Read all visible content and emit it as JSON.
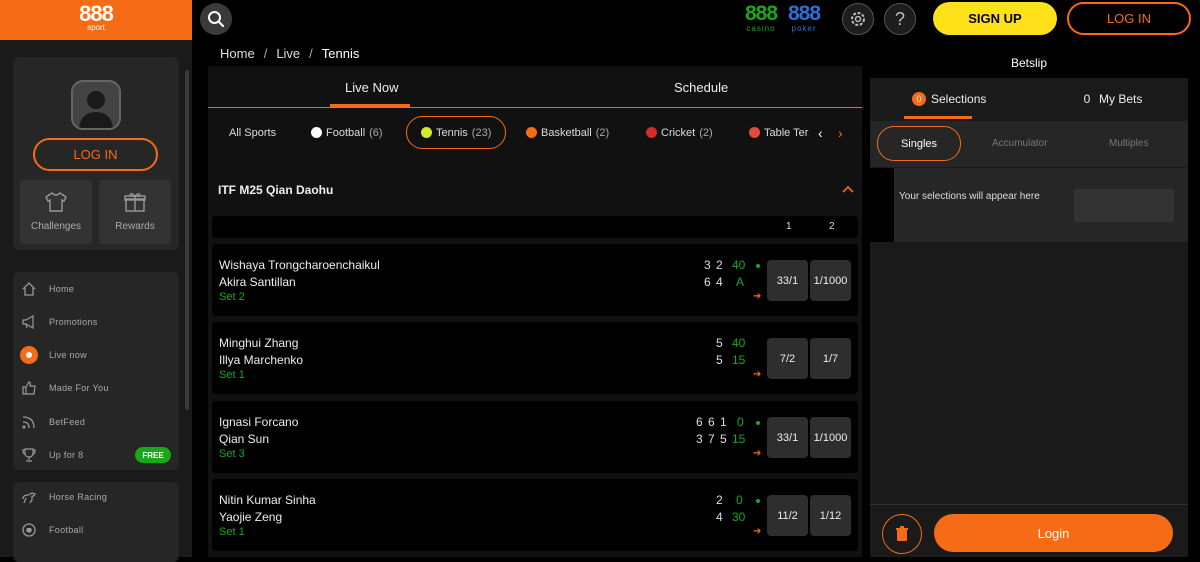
{
  "logo": {
    "main": "888",
    "sub": "sport"
  },
  "brands": [
    {
      "main": "888",
      "sub": "casino",
      "color": "#18a81a"
    },
    {
      "main": "888",
      "sub": "poker",
      "color": "#2b6fd6"
    }
  ],
  "header": {
    "signup_label": "SIGN UP",
    "login_label": "LOG IN"
  },
  "sidebar": {
    "login_label": "LOG IN",
    "tiles": [
      {
        "label": "Challenges",
        "icon": "shirt-icon"
      },
      {
        "label": "Rewards",
        "icon": "gift-icon"
      }
    ],
    "nav": [
      {
        "label": "Home",
        "icon": "home-icon"
      },
      {
        "label": "Promotions",
        "icon": "megaphone-icon"
      },
      {
        "label": "Live now",
        "icon": "live-icon"
      },
      {
        "label": "Made For You",
        "icon": "thumbs-up-icon"
      },
      {
        "label": "BetFeed",
        "icon": "feed-icon"
      },
      {
        "label": "Up for 8",
        "icon": "trophy-icon",
        "badge": "FREE"
      }
    ],
    "nav2": [
      {
        "label": "Horse Racing",
        "icon": "horse-icon"
      },
      {
        "label": "Football",
        "icon": "football-icon"
      }
    ]
  },
  "breadcrumb": {
    "items": [
      "Home",
      "Live",
      "Tennis"
    ]
  },
  "tabs": {
    "live_now": "Live Now",
    "schedule": "Schedule"
  },
  "sports": [
    {
      "label": "All Sports",
      "count": ""
    },
    {
      "label": "Football",
      "count": "(6)"
    },
    {
      "label": "Tennis",
      "count": "(23)"
    },
    {
      "label": "Basketball",
      "count": "(2)"
    },
    {
      "label": "Cricket",
      "count": "(2)"
    },
    {
      "label": "Table Ter",
      "count": ""
    }
  ],
  "league": {
    "name": "ITF M25 Qian Daohu"
  },
  "columns": {
    "c1": "1",
    "c2": "2"
  },
  "matches": [
    {
      "p1": "Wishaya Trongcharoenchaikul",
      "p2": "Akira Santillan",
      "set": "Set 2",
      "s1": [
        "3",
        "2",
        "40"
      ],
      "s2": [
        "6",
        "4",
        "A"
      ],
      "odd1": "33/1",
      "odd2": "1/1000"
    },
    {
      "p1": "Minghui Zhang",
      "p2": "Illya Marchenko",
      "set": "Set 1",
      "s1": [
        "5",
        "40"
      ],
      "s2": [
        "5",
        "15"
      ],
      "odd1": "7/2",
      "odd2": "1/7"
    },
    {
      "p1": "Ignasi Forcano",
      "p2": "Qian Sun",
      "set": "Set 3",
      "s1": [
        "6",
        "6",
        "1",
        "0"
      ],
      "s2": [
        "3",
        "7",
        "5",
        "15"
      ],
      "odd1": "33/1",
      "odd2": "1/1000"
    },
    {
      "p1": "Nitin Kumar Sinha",
      "p2": "Yaojie Zeng",
      "set": "Set 1",
      "s1": [
        "2",
        "0"
      ],
      "s2": [
        "4",
        "30"
      ],
      "odd1": "11/2",
      "odd2": "1/12"
    }
  ],
  "betslip": {
    "title": "Betslip",
    "selections_count": "0",
    "selections_label": "Selections",
    "mybets_count": "0",
    "mybets_label": "My Bets",
    "types": [
      "Singles",
      "Accumulator",
      "Multiples"
    ],
    "empty_message": "Your selections will appear here",
    "login_label": "Login"
  },
  "colors": {
    "accent": "#f56b16",
    "live_green": "#18a81a",
    "signup": "#ffe11a"
  }
}
